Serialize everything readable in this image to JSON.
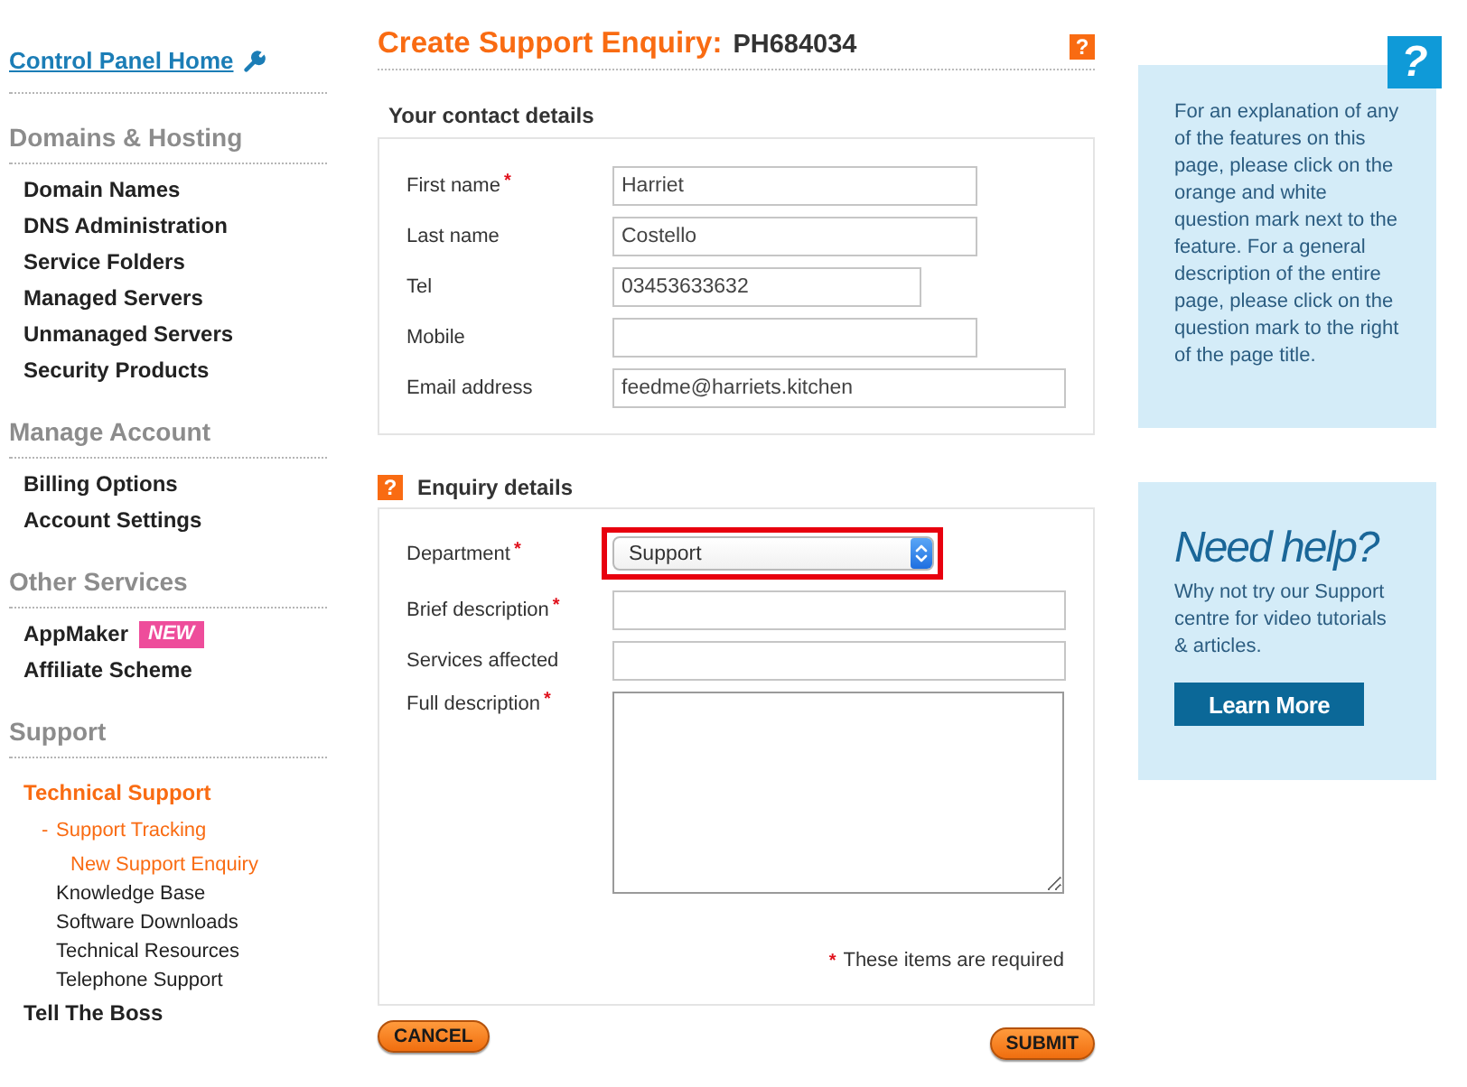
{
  "sidebar": {
    "home_link": "Control Panel Home",
    "sections": [
      {
        "title": "Domains & Hosting",
        "items": [
          {
            "label": "Domain Names",
            "selected": false
          },
          {
            "label": "DNS Administration",
            "selected": false
          },
          {
            "label": "Service Folders",
            "selected": false
          },
          {
            "label": "Managed Servers",
            "selected": false
          },
          {
            "label": "Unmanaged Servers",
            "selected": false
          },
          {
            "label": "Security Products",
            "selected": false
          }
        ]
      },
      {
        "title": "Manage Account",
        "items": [
          {
            "label": "Billing Options",
            "selected": false
          },
          {
            "label": "Account Settings",
            "selected": false
          }
        ]
      },
      {
        "title": "Other Services",
        "items": [
          {
            "label": "AppMaker",
            "selected": false,
            "badge": "NEW"
          },
          {
            "label": "Affiliate Scheme",
            "selected": false
          }
        ]
      },
      {
        "title": "Support",
        "items": [
          {
            "label": "Technical Support",
            "selected": true,
            "children": [
              {
                "label": "Support Tracking",
                "selected": true,
                "marker": "-",
                "children": [
                  {
                    "label": "New Support Enquiry",
                    "selected": true
                  }
                ]
              },
              {
                "label": "Knowledge Base",
                "selected": false
              },
              {
                "label": "Software Downloads",
                "selected": false
              },
              {
                "label": "Technical Resources",
                "selected": false
              },
              {
                "label": "Telephone Support",
                "selected": false
              }
            ]
          },
          {
            "label": "Tell The Boss",
            "selected": false
          }
        ]
      }
    ]
  },
  "page": {
    "title": "Create Support Enquiry:",
    "reference": "PH684034",
    "help": "?"
  },
  "contact_details": {
    "heading": "Your contact details",
    "fields": [
      {
        "label": "First name",
        "required_mark": "*",
        "kind": "text",
        "value": "Harriet",
        "highlighted": false
      },
      {
        "label": "Last name",
        "kind": "text",
        "value": "Costello",
        "highlighted": false
      },
      {
        "label": "Tel",
        "kind": "tel",
        "value": "03453633632",
        "highlighted": false
      },
      {
        "label": "Mobile",
        "kind": "text",
        "highlighted": false
      },
      {
        "label": "Email address",
        "kind": "email",
        "value": "feedme@harriets.kitchen",
        "highlighted": false
      }
    ]
  },
  "enquiry_details": {
    "help": "?",
    "heading": "Enquiry details",
    "fields": [
      {
        "label": "Department",
        "required_mark": "*",
        "kind": "select",
        "value": "Support",
        "highlighted": true
      },
      {
        "label": "Brief description",
        "required_mark": "*",
        "kind": "long-text",
        "highlighted": false
      },
      {
        "label": "Services affected",
        "kind": "long-text",
        "highlighted": false
      },
      {
        "label": "Full description",
        "required_mark": "*",
        "kind": "textarea",
        "highlighted": false
      }
    ],
    "note_mark": "*",
    "note": "These items are required"
  },
  "buttons": [
    {
      "label": "CANCEL",
      "kind": "cancel"
    },
    {
      "label": "SUBMIT",
      "kind": "submit"
    }
  ],
  "info_panel": {
    "help": "?",
    "text": "For an explanation of any of the features on this page, please click on the orange and white question mark next to the feature. For a general description of the entire page, please click on the question mark to the right of the page title."
  },
  "help_panel": {
    "heading": "Need help?",
    "text": "Why not try our Support centre for video tutorials & articles.",
    "button": "Learn More"
  }
}
